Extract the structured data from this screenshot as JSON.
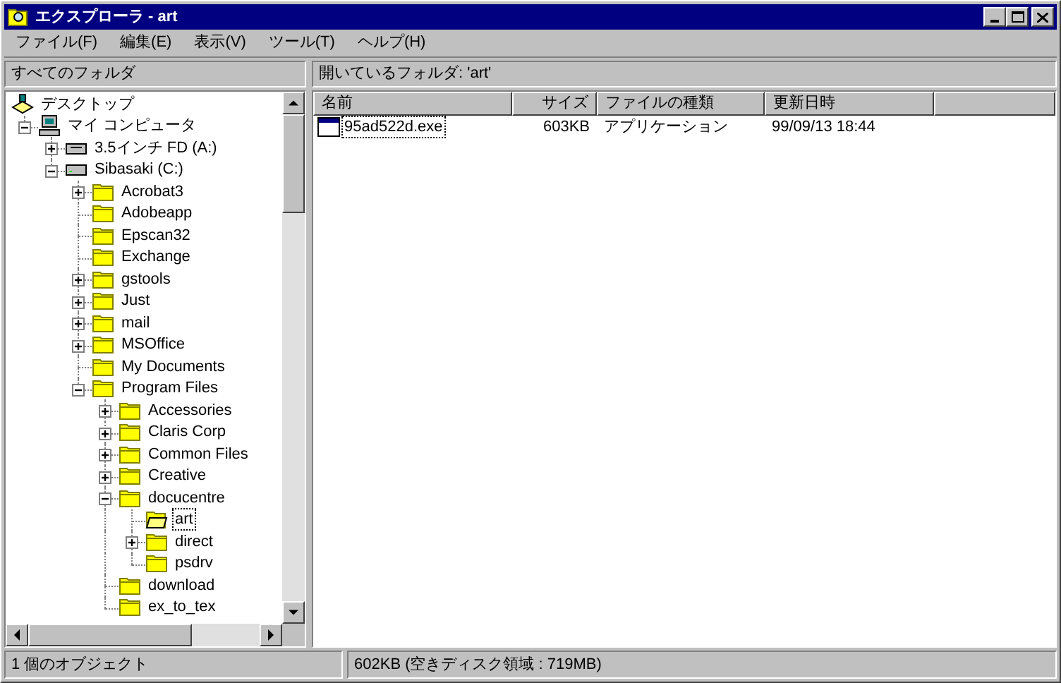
{
  "window": {
    "title": "エクスプローラ - art"
  },
  "menu": [
    "ファイル(F)",
    "編集(E)",
    "表示(V)",
    "ツール(T)",
    "ヘルプ(H)"
  ],
  "left_pane": {
    "header": "すべてのフォルダ",
    "tree": [
      {
        "label": "デスクトップ",
        "kind": "desktop",
        "selected": false,
        "children": [
          {
            "label": "マイ コンピュータ",
            "kind": "computer",
            "expandable": true,
            "expanded": true,
            "selected": false,
            "children": [
              {
                "label": "3.5インチ FD (A:)",
                "kind": "floppy",
                "expandable": true,
                "expanded": false,
                "selected": false
              },
              {
                "label": "Sibasaki (C:)",
                "kind": "drive",
                "expandable": true,
                "expanded": true,
                "selected": false,
                "children": [
                  {
                    "label": "Acrobat3",
                    "kind": "folder",
                    "expandable": true,
                    "expanded": false,
                    "selected": false
                  },
                  {
                    "label": "Adobeapp",
                    "kind": "folder",
                    "expandable": false,
                    "selected": false
                  },
                  {
                    "label": "Epscan32",
                    "kind": "folder",
                    "expandable": false,
                    "selected": false
                  },
                  {
                    "label": "Exchange",
                    "kind": "folder",
                    "expandable": false,
                    "selected": false
                  },
                  {
                    "label": "gstools",
                    "kind": "folder",
                    "expandable": true,
                    "expanded": false,
                    "selected": false
                  },
                  {
                    "label": "Just",
                    "kind": "folder",
                    "expandable": true,
                    "expanded": false,
                    "selected": false
                  },
                  {
                    "label": "mail",
                    "kind": "folder",
                    "expandable": true,
                    "expanded": false,
                    "selected": false
                  },
                  {
                    "label": "MSOffice",
                    "kind": "folder",
                    "expandable": true,
                    "expanded": false,
                    "selected": false
                  },
                  {
                    "label": "My Documents",
                    "kind": "folder",
                    "expandable": false,
                    "selected": false
                  },
                  {
                    "label": "Program Files",
                    "kind": "folder",
                    "expandable": true,
                    "expanded": true,
                    "selected": false,
                    "children": [
                      {
                        "label": "Accessories",
                        "kind": "folder",
                        "expandable": true,
                        "expanded": false,
                        "selected": false
                      },
                      {
                        "label": "Claris Corp",
                        "kind": "folder",
                        "expandable": true,
                        "expanded": false,
                        "selected": false
                      },
                      {
                        "label": "Common Files",
                        "kind": "folder",
                        "expandable": true,
                        "expanded": false,
                        "selected": false
                      },
                      {
                        "label": "Creative",
                        "kind": "folder",
                        "expandable": true,
                        "expanded": false,
                        "selected": false
                      },
                      {
                        "label": "docucentre",
                        "kind": "folder",
                        "expandable": true,
                        "expanded": true,
                        "selected": false,
                        "children": [
                          {
                            "label": "art",
                            "kind": "folder",
                            "expandable": false,
                            "selected": true
                          },
                          {
                            "label": "direct",
                            "kind": "folder",
                            "expandable": true,
                            "expanded": false,
                            "selected": false
                          },
                          {
                            "label": "psdrv",
                            "kind": "folder",
                            "expandable": false,
                            "selected": false
                          }
                        ]
                      },
                      {
                        "label": "download",
                        "kind": "folder",
                        "expandable": false,
                        "selected": false
                      },
                      {
                        "label": "ex_to_tex",
                        "kind": "folder",
                        "expandable": false,
                        "selected": false
                      }
                    ]
                  }
                ]
              }
            ]
          }
        ]
      }
    ]
  },
  "right_pane": {
    "header": "開いているフォルダ: 'art'",
    "columns": [
      "名前",
      "サイズ",
      "ファイルの種類",
      "更新日時"
    ],
    "rows": [
      {
        "name": "95ad522d.exe",
        "size": "603KB",
        "type": "アプリケーション",
        "modified": "99/09/13 18:44",
        "focused": true
      }
    ]
  },
  "status_bar": [
    "1 個のオブジェクト",
    "602KB (空きディスク領域 : 719MB)"
  ]
}
